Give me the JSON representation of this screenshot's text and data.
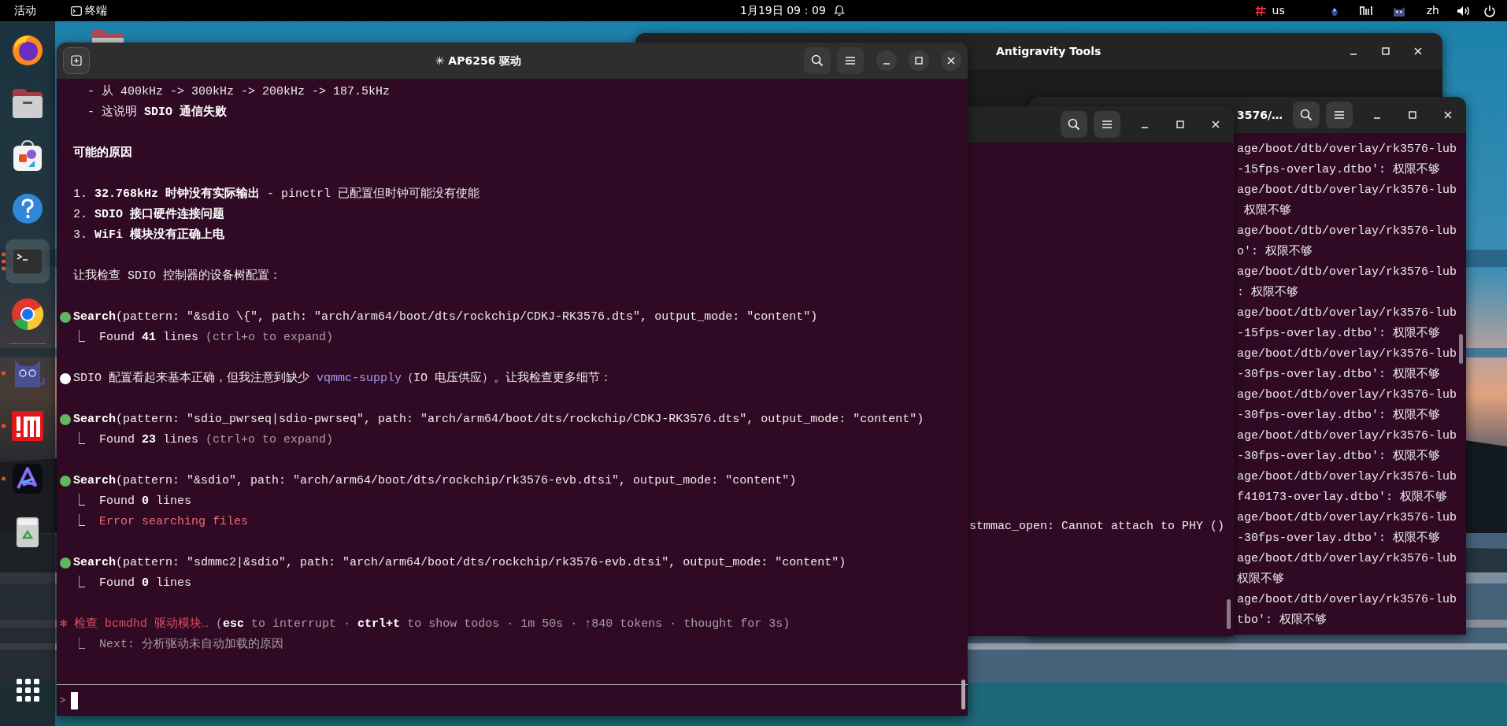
{
  "top_bar": {
    "activities": "活动",
    "app_name": "终端",
    "clock": "1月19日 09：09",
    "tray": [
      {
        "kind": "input-method"
      },
      {
        "kind": "text",
        "label": "us"
      },
      {
        "kind": "figure"
      },
      {
        "kind": "bars"
      },
      {
        "kind": "cat"
      },
      {
        "kind": "text",
        "label": "zh"
      },
      {
        "kind": "volume"
      },
      {
        "kind": "power"
      }
    ]
  },
  "dock": {
    "items": [
      {
        "kind": "firefox",
        "running": false,
        "selected": false
      },
      {
        "kind": "files",
        "running": false,
        "selected": false
      },
      {
        "kind": "app-center",
        "running": false,
        "selected": false
      },
      {
        "kind": "help",
        "running": false,
        "selected": false
      },
      {
        "kind": "terminal",
        "running": true,
        "multiple": true,
        "selected": true
      },
      {
        "kind": "chrome",
        "running": false,
        "selected": false
      },
      {
        "kind": "separator"
      },
      {
        "kind": "cat",
        "running": true,
        "multiple": false,
        "selected": false
      },
      {
        "kind": "red-app",
        "running": true,
        "multiple": false,
        "selected": false
      },
      {
        "kind": "a-app",
        "running": true,
        "multiple": false,
        "selected": false
      },
      {
        "kind": "trash",
        "running": false,
        "selected": false
      }
    ]
  },
  "background_windows": [
    {
      "kind": "app",
      "title": "Antigravity Tools"
    },
    {
      "kind": "terminal",
      "title": "3576/…",
      "lines": [
        "age/boot/dtb/overlay/rk3576-lub",
        "-15fps-overlay.dtbo': 权限不够",
        "age/boot/dtb/overlay/rk3576-lub",
        " 权限不够",
        "age/boot/dtb/overlay/rk3576-lub",
        "o': 权限不够",
        "age/boot/dtb/overlay/rk3576-lub",
        ": 权限不够",
        "age/boot/dtb/overlay/rk3576-lub",
        "-15fps-overlay.dtbo': 权限不够",
        "age/boot/dtb/overlay/rk3576-lub",
        "-30fps-overlay.dtbo': 权限不够",
        "age/boot/dtb/overlay/rk3576-lub",
        "-30fps-overlay.dtbo': 权限不够",
        "age/boot/dtb/overlay/rk3576-lub",
        "-30fps-overlay.dtbo': 权限不够",
        "age/boot/dtb/overlay/rk3576-lub",
        "f410173-overlay.dtbo': 权限不够",
        "age/boot/dtb/overlay/rk3576-lub",
        "-30fps-overlay.dtbo': 权限不够",
        "age/boot/dtb/overlay/rk3576-lub",
        "权限不够",
        "age/boot/dtb/overlay/rk3576-lub",
        "tbo': 权限不够"
      ]
    },
    {
      "kind": "terminal",
      "lines": [
        "stmmac_open: Cannot attach to PHY ()"
      ]
    }
  ],
  "main_terminal": {
    "title": "✳ AP6256 驱动",
    "prompt": ">",
    "blocks": [
      {
        "lines": [
          {
            "kind": "sub",
            "text": "- 从 400kHz -> 300kHz -> 200kHz -> 187.5kHz"
          },
          {
            "kind": "sub",
            "text": "- 这说明 **SDIO 通信失败**"
          }
        ]
      },
      {
        "lines": [
          {
            "kind": "heading",
            "text": "可能的原因"
          }
        ]
      },
      {
        "lines": [
          {
            "kind": "plain",
            "text": "1. **32.768kHz 时钟没有实际输出** - pinctrl 已配置但时钟可能没有使能"
          },
          {
            "kind": "plain",
            "text": "2. **SDIO 接口硬件连接问题**"
          },
          {
            "kind": "plain",
            "text": "3. **WiFi 模块没有正确上电**"
          }
        ]
      },
      {
        "lines": [
          {
            "kind": "plain",
            "text": "让我检查 SDIO 控制器的设备树配置："
          }
        ]
      },
      {
        "lines": [
          {
            "kind": "plain",
            "color": "#5fb760",
            "text": "**Search**(pattern: \"&sdio \\{\", path: \"arch/arm64/boot/dts/rockchip/CDKJ-RK3576.dts\", output_mode: \"content\")"
          },
          {
            "kind": "plain",
            "segments": [
              {
                "kind": "plain",
                "text": "⎿  Found **41** lines "
              },
              {
                "kind": "dim",
                "text": "(ctrl+o to expand)"
              }
            ]
          }
        ]
      },
      {
        "lines": [
          {
            "kind": "plain",
            "color": "#ffffff",
            "segments": [
              {
                "kind": "plain",
                "text": "SDIO 配置看起来基本正确，但我注意到缺少 "
              },
              {
                "kind": "accent",
                "text": "vqmmc-supply"
              },
              {
                "kind": "plain",
                "text": "（IO 电压供应）。让我检查更多细节："
              }
            ]
          }
        ]
      },
      {
        "lines": [
          {
            "kind": "plain",
            "color": "#5fb760",
            "text": "**Search**(pattern: \"sdio_pwrseq|sdio-pwrseq\", path: \"arch/arm64/boot/dts/rockchip/CDKJ-RK3576.dts\", output_mode: \"content\")"
          },
          {
            "kind": "plain",
            "segments": [
              {
                "kind": "plain",
                "text": "⎿  Found **23** lines "
              },
              {
                "kind": "dim",
                "text": "(ctrl+o to expand)"
              }
            ]
          }
        ]
      },
      {
        "lines": [
          {
            "kind": "plain",
            "color": "#5fb760",
            "text": "**Search**(pattern: \"&sdio\", path: \"arch/arm64/boot/dts/rockchip/rk3576-evb.dtsi\", output_mode: \"content\")"
          },
          {
            "kind": "plain",
            "text": "⎿  Found **0** lines"
          },
          {
            "kind": "plain",
            "segments": [
              {
                "kind": "plain",
                "text": "⎿  "
              },
              {
                "kind": "error",
                "text": "Error searching files"
              }
            ]
          }
        ]
      },
      {
        "lines": [
          {
            "kind": "plain",
            "color": "#5fb760",
            "text": "**Search**(pattern: \"sdmmc2|&sdio\", path: \"arch/arm64/boot/dts/rockchip/rk3576-evb.dtsi\", output_mode: \"content\")"
          },
          {
            "kind": "plain",
            "text": "⎿  Found **0** lines"
          }
        ]
      },
      {
        "lines": [
          {
            "kind": "status",
            "segments": [
              {
                "kind": "spin",
                "text": "✻ 检查 bcmdhd 驱动模块…"
              },
              {
                "kind": "dim",
                "text": " (**esc** to interrupt · **ctrl+t** to show todos · 1m 50s · ↑840 tokens · thought for 3s)"
              }
            ]
          },
          {
            "kind": "plain",
            "segments": [
              {
                "kind": "dim",
                "text": "⎿  Next: 分析驱动未自动加载的原因"
              }
            ]
          }
        ]
      }
    ]
  }
}
